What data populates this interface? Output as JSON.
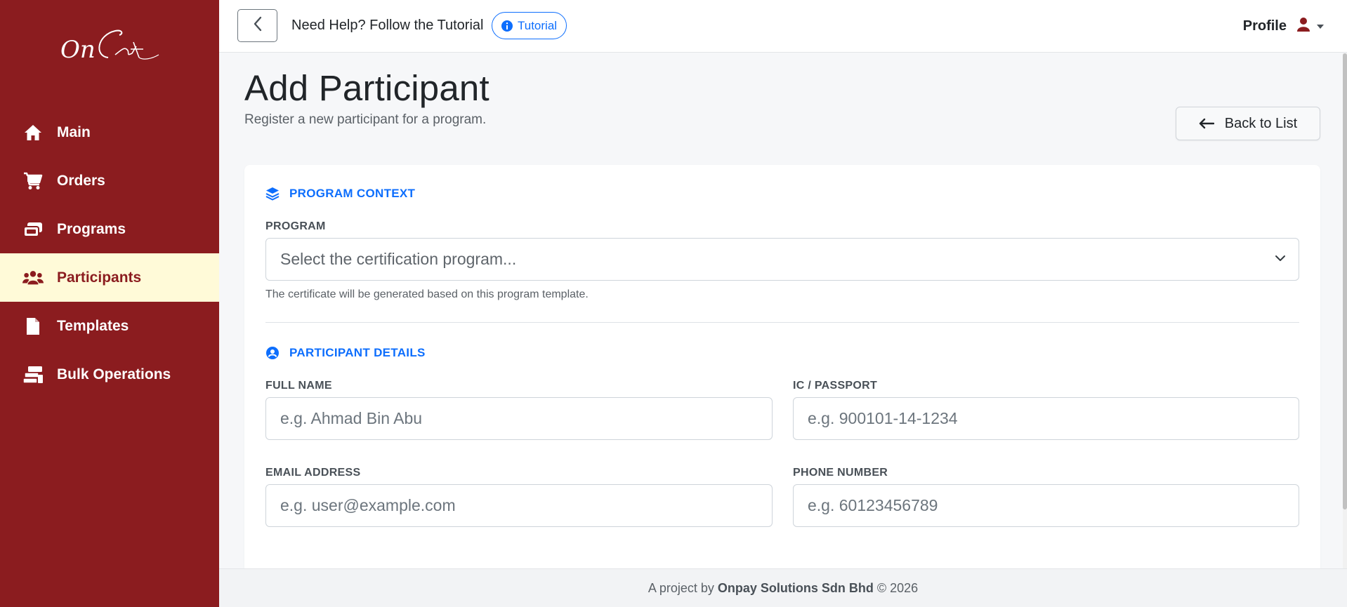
{
  "sidebar": {
    "logo_text": "OnCert",
    "items": [
      {
        "label": "Main",
        "icon": "home-icon"
      },
      {
        "label": "Orders",
        "icon": "cart-icon"
      },
      {
        "label": "Programs",
        "icon": "ticket-icon"
      },
      {
        "label": "Participants",
        "icon": "users-icon"
      },
      {
        "label": "Templates",
        "icon": "file-icon"
      },
      {
        "label": "Bulk Operations",
        "icon": "stack-icon"
      }
    ],
    "active_item": "Participants"
  },
  "topbar": {
    "help_text": "Need Help? Follow the Tutorial",
    "tutorial_label": "Tutorial",
    "profile_label": "Profile"
  },
  "page": {
    "title": "Add Participant",
    "subtitle": "Register a new participant for a program.",
    "back_to_list_label": "Back to List"
  },
  "form": {
    "program_context": {
      "heading": "PROGRAM CONTEXT",
      "program_label": "PROGRAM",
      "program_placeholder": "Select the certification program...",
      "program_help": "The certificate will be generated based on this program template."
    },
    "participant_details": {
      "heading": "PARTICIPANT DETAILS",
      "full_name_label": "FULL NAME",
      "full_name_placeholder": "e.g. Ahmad Bin Abu",
      "ic_label": "IC / PASSPORT",
      "ic_placeholder": "e.g. 900101-14-1234",
      "email_label": "EMAIL ADDRESS",
      "email_placeholder": "e.g. user@example.com",
      "phone_label": "PHONE NUMBER",
      "phone_placeholder": "e.g. 60123456789"
    }
  },
  "footer": {
    "prefix": "A project by",
    "company": "Onpay Solutions Sdn Bhd",
    "suffix": "© 2026"
  },
  "colors": {
    "sidebar_bg": "#8b1c1f",
    "active_bg": "#fffad8",
    "accent": "#0d6efd"
  }
}
